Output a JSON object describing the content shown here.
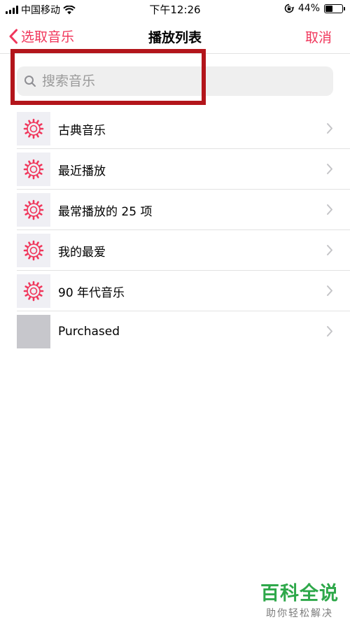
{
  "status_bar": {
    "carrier": "中国移动",
    "time": "下午12:26",
    "battery_text": "44%",
    "battery_level": 0.44
  },
  "nav": {
    "back_label": "选取音乐",
    "title": "播放列表",
    "cancel_label": "取消"
  },
  "search": {
    "placeholder": "搜索音乐"
  },
  "playlists": [
    {
      "label": "古典音乐",
      "icon": "gear-icon"
    },
    {
      "label": "最近播放",
      "icon": "gear-icon"
    },
    {
      "label": "最常播放的 25 项",
      "icon": "gear-icon"
    },
    {
      "label": "我的最爱",
      "icon": "gear-icon"
    },
    {
      "label": "90 年代音乐",
      "icon": "gear-icon"
    },
    {
      "label": "Purchased",
      "icon": ""
    }
  ],
  "watermark": {
    "title": "百科全说",
    "subtitle": "助你轻松解决"
  },
  "colors": {
    "accent": "#f0365b",
    "highlight": "#b3151b",
    "watermark": "#2ea84a"
  }
}
